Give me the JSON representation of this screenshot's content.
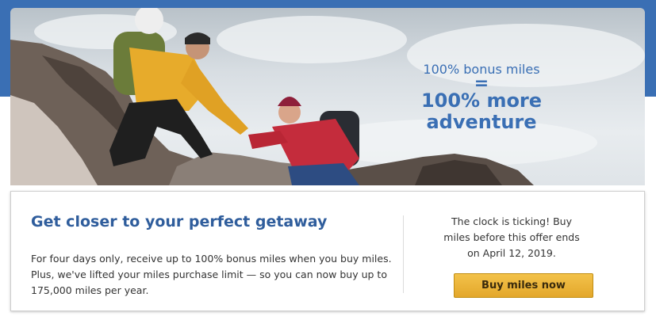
{
  "hero": {
    "line1": "100% bonus miles",
    "line2": "=",
    "line3": "100% more",
    "line4": "adventure",
    "text_color": "#3a6fb4"
  },
  "promo": {
    "title": "Get closer to your perfect getaway",
    "body": "For four days only, receive up to 100% bonus miles when you buy miles. Plus, we've lifted your miles purchase limit — so you can now buy up to 175,000 miles per year.",
    "countdown": "The clock is ticking! Buy miles before this offer ends on April 12, 2019.",
    "cta_label": "Buy miles now"
  },
  "colors": {
    "brand_blue": "#3a6fb4",
    "title_blue": "#2f5d9c",
    "button_gold": "#e8b13a"
  }
}
